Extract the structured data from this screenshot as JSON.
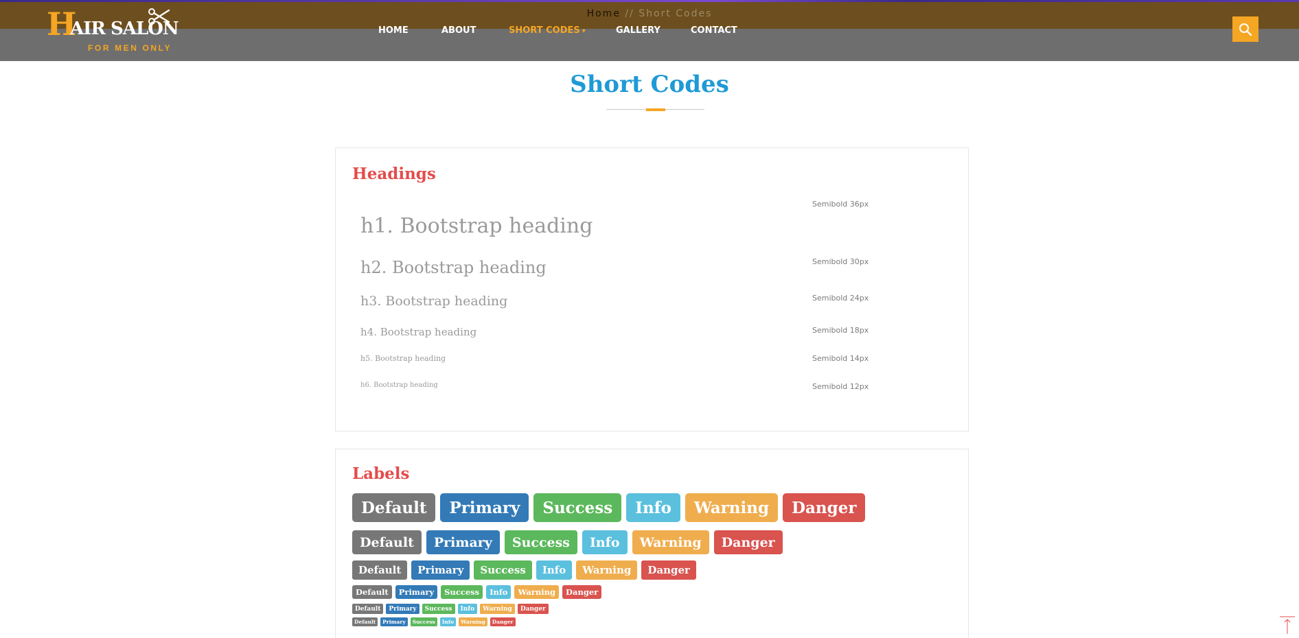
{
  "header": {
    "breadcrumb": {
      "home": "Home",
      "separator": " // ",
      "current": "Short Codes"
    },
    "logo": {
      "initial": "H",
      "rest": "AIR SALON",
      "tagline": "FOR MEN ONLY",
      "icon": "scissors-icon"
    },
    "nav": [
      {
        "label": "HOME",
        "active": false
      },
      {
        "label": "ABOUT",
        "active": false
      },
      {
        "label": "SHORT CODES",
        "active": true,
        "has_dropdown": true
      },
      {
        "label": "GALLERY",
        "active": false
      },
      {
        "label": "CONTACT",
        "active": false
      }
    ],
    "search_icon": "search-icon",
    "colors": {
      "accent": "#f5a623",
      "top_band": "#6d4e1e",
      "bar": "#6e6e6e"
    }
  },
  "page": {
    "title": "Short Codes",
    "title_color": "#1f9ad6"
  },
  "headings_panel": {
    "title": "Headings",
    "rows": [
      {
        "text": "h1. Bootstrap heading",
        "note": "Semibold 36px"
      },
      {
        "text": "h2. Bootstrap heading",
        "note": "Semibold 30px"
      },
      {
        "text": "h3. Bootstrap heading",
        "note": "Semibold 24px"
      },
      {
        "text": "h4. Bootstrap heading",
        "note": "Semibold 18px"
      },
      {
        "text": "h5. Bootstrap heading",
        "note": "Semibold 14px"
      },
      {
        "text": "h6. Bootstrap heading",
        "note": "Semibold 12px"
      }
    ]
  },
  "labels_panel": {
    "title": "Labels",
    "labels": [
      "Default",
      "Primary",
      "Success",
      "Info",
      "Warning",
      "Danger"
    ],
    "colors": {
      "default": "#777777",
      "primary": "#337ab7",
      "success": "#5cb85c",
      "info": "#5bc0de",
      "warning": "#f0ad4e",
      "danger": "#d9534f"
    }
  },
  "back_to_top_icon": "arrow-up-icon"
}
